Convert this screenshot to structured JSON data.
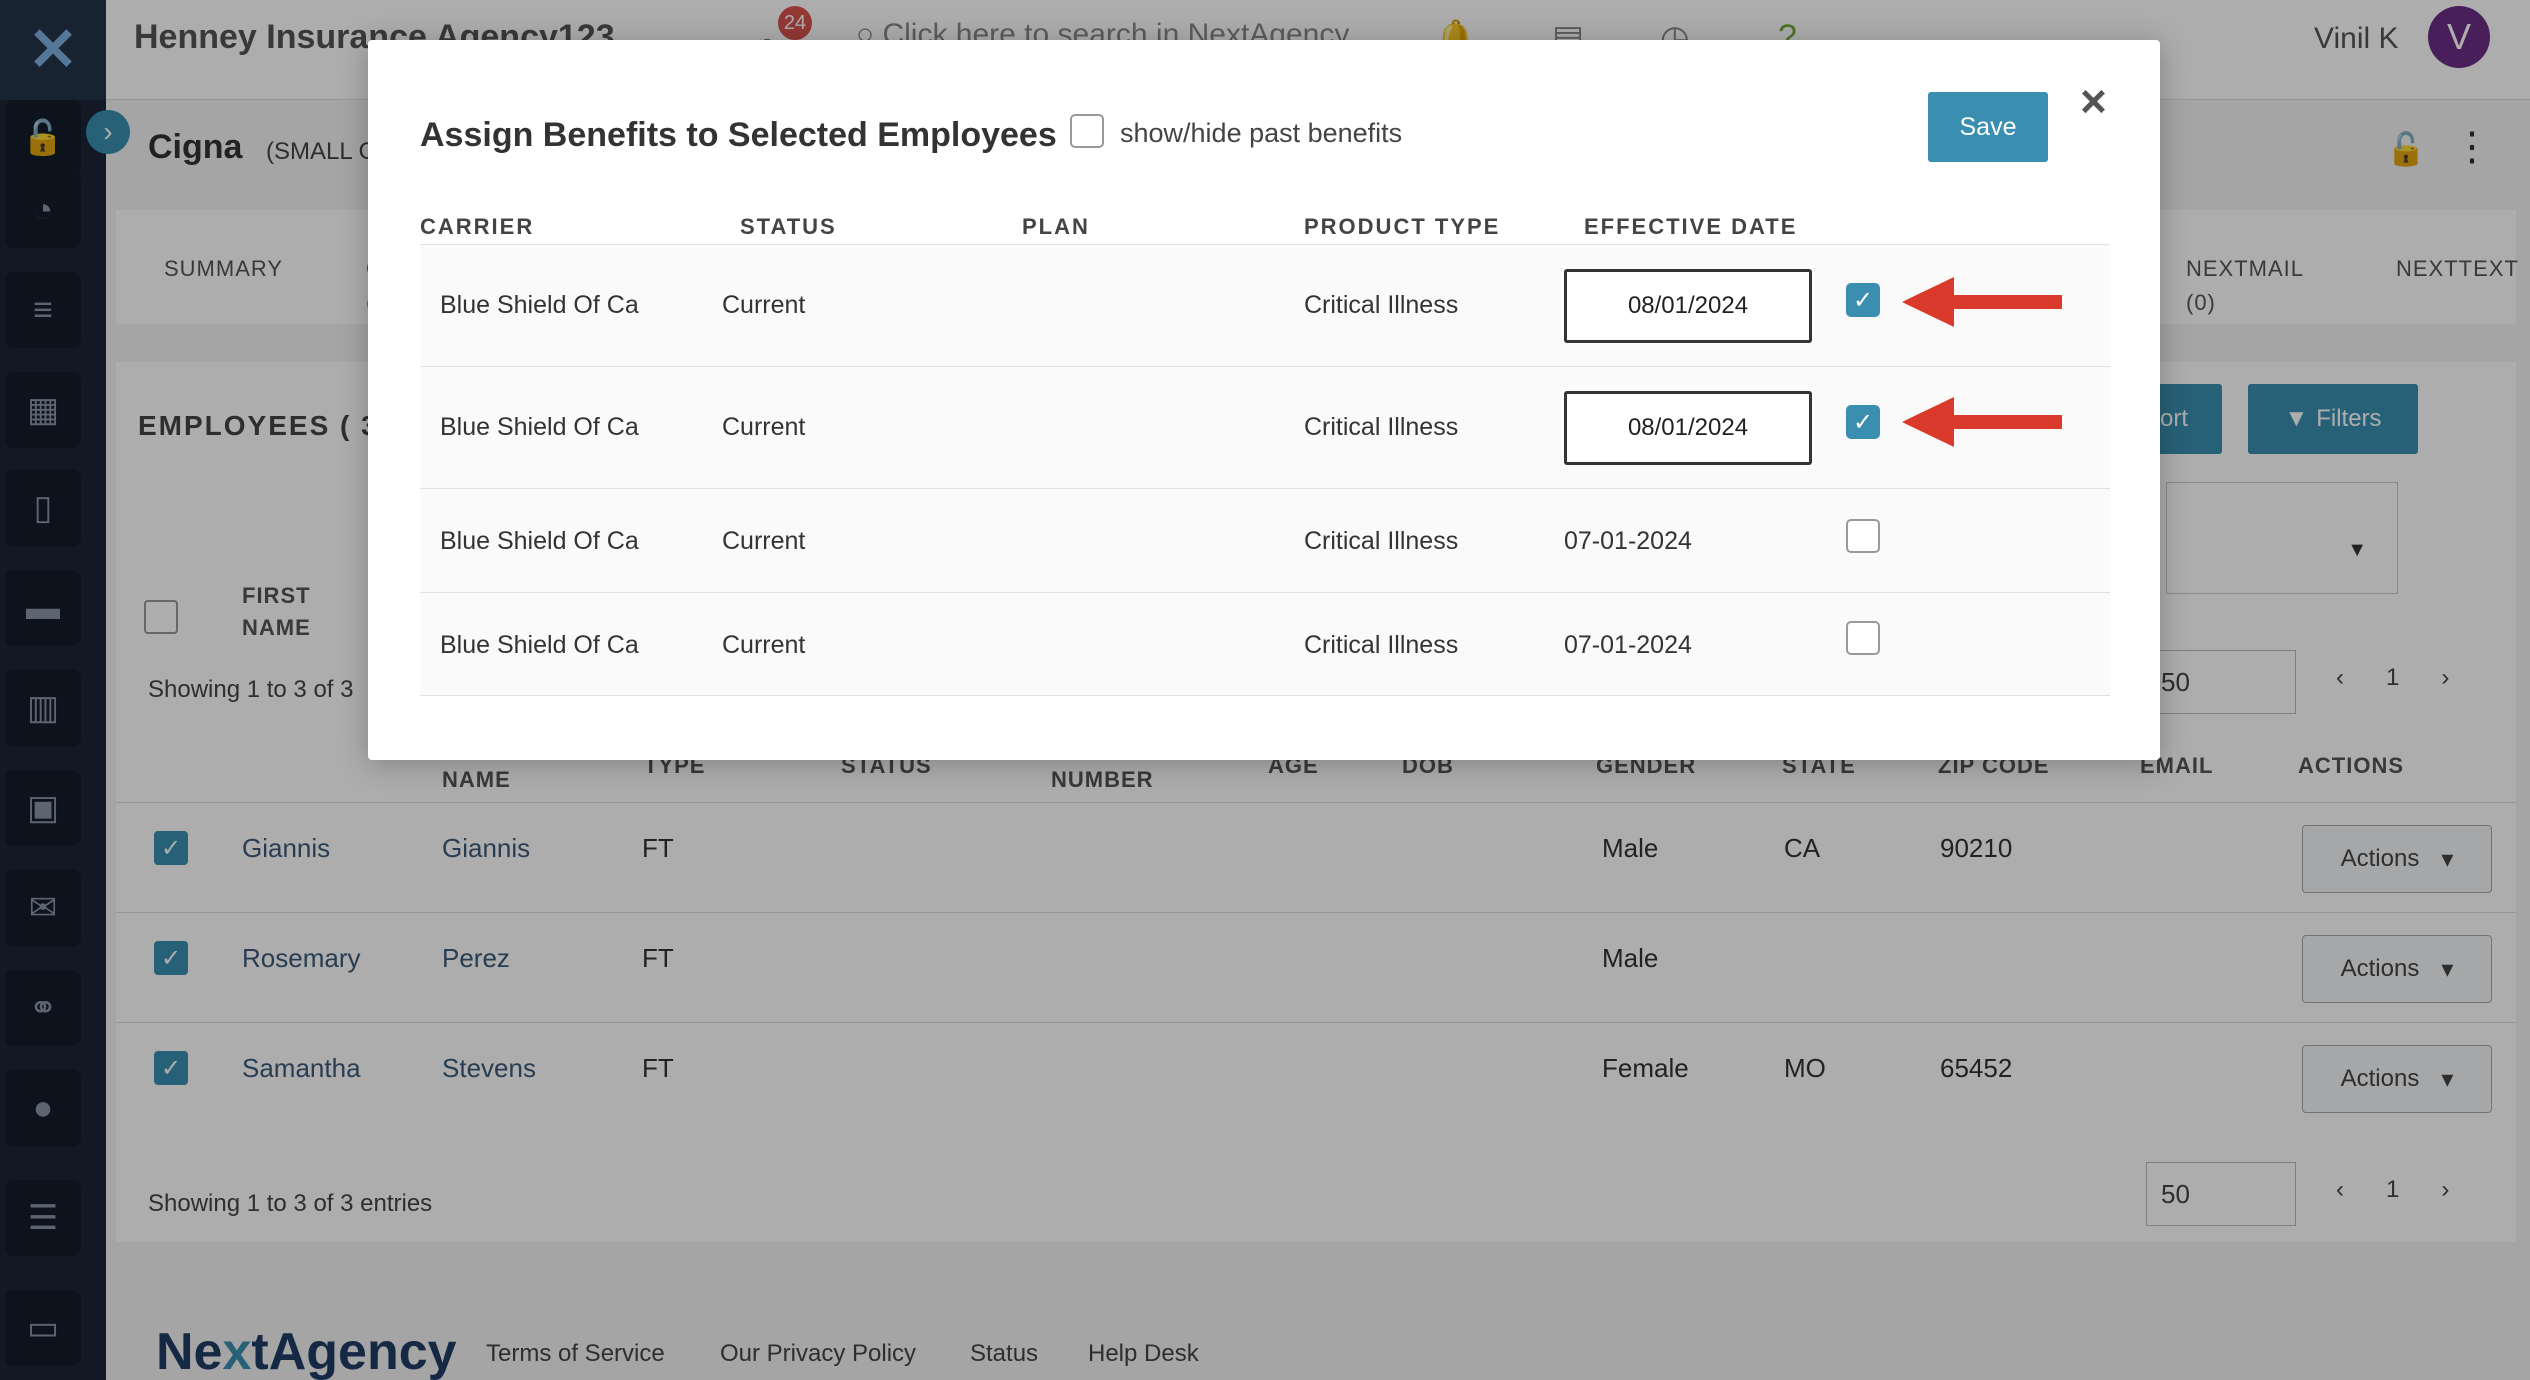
{
  "topbar": {
    "agency_name": "Henney Insurance Agency123",
    "notification_count": "24",
    "search_placeholder": "Click here to search in NextAgency",
    "user_name": "Vinil K",
    "avatar_letter": "V"
  },
  "page": {
    "client_name": "Cigna",
    "client_sub": "(SMALL G",
    "tabs": [
      {
        "label": "SUMMARY"
      },
      {
        "label": "C\n("
      },
      {
        "label": "NEXTMAIL\n(0)"
      },
      {
        "label": "NEXTTEXT"
      }
    ]
  },
  "employees": {
    "heading": "EMPLOYEES ( 3",
    "export_label": "ort",
    "filters_label": "Filters",
    "showing_top": "Showing 1 to 3 of 3",
    "showing_bottom": "Showing 1 to 3 of 3 entries",
    "page_size": "50",
    "page_number": "1",
    "columns": [
      "FIRST\nNAME",
      "NAME",
      "TYPE",
      "STATUS",
      "NUMBER",
      "AGE",
      "DOB",
      "GENDER",
      "STATE",
      "ZIP CODE",
      "EMAIL",
      "ACTIONS"
    ],
    "rows": [
      {
        "first": "Giannis",
        "last": "Giannis",
        "type": "FT",
        "gender": "Male",
        "state": "CA",
        "zip": "90210",
        "actions": "Actions"
      },
      {
        "first": "Rosemary",
        "last": "Perez",
        "type": "FT",
        "gender": "Male",
        "state": "",
        "zip": "",
        "actions": "Actions"
      },
      {
        "first": "Samantha",
        "last": "Stevens",
        "type": "FT",
        "gender": "Female",
        "state": "MO",
        "zip": "65452",
        "actions": "Actions"
      }
    ]
  },
  "footer": {
    "logo_prefix": "Ne",
    "logo_x": "x",
    "logo_suffix": "tAgency",
    "links": [
      "Terms of Service",
      "Our Privacy Policy",
      "Status",
      "Help Desk"
    ]
  },
  "modal": {
    "title": "Assign Benefits to Selected Employees",
    "past_benefits_label": "show/hide past benefits",
    "save_label": "Save",
    "close_label": "×",
    "headers": [
      "CARRIER",
      "STATUS",
      "PLAN",
      "PRODUCT TYPE",
      "EFFECTIVE DATE"
    ],
    "rows": [
      {
        "carrier": "Blue Shield Of Ca",
        "status": "Current",
        "plan": "",
        "product_type": "Critical Illness",
        "effective_date": "08/01/2024",
        "editable": true,
        "checked": true
      },
      {
        "carrier": "Blue Shield Of Ca",
        "status": "Current",
        "plan": "",
        "product_type": "Critical Illness",
        "effective_date": "08/01/2024",
        "editable": true,
        "checked": true
      },
      {
        "carrier": "Blue Shield Of Ca",
        "status": "Current",
        "plan": "",
        "product_type": "Critical Illness",
        "effective_date": "07-01-2024",
        "editable": false,
        "checked": false
      },
      {
        "carrier": "Blue Shield Of Ca",
        "status": "Current",
        "plan": "",
        "product_type": "Critical Illness",
        "effective_date": "07-01-2024",
        "editable": false,
        "checked": false
      }
    ]
  },
  "colors": {
    "accent": "#3a8fb0",
    "sidebar": "#1b2636",
    "arrow": "#d93a2b",
    "avatar": "#6b2d86"
  }
}
